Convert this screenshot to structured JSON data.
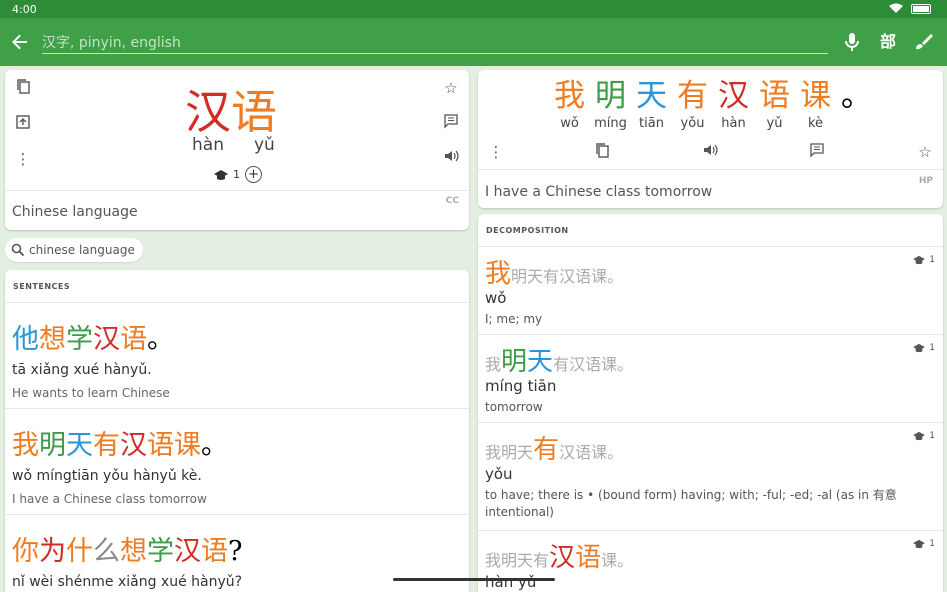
{
  "status": {
    "time": "4:00"
  },
  "toolbar": {
    "search_placeholder": "汉字, pinyin, english",
    "radical_label": "部"
  },
  "word": {
    "chars": [
      "汉",
      "语"
    ],
    "pinyin": [
      "hàn",
      "yǔ"
    ],
    "hsk_level": "1",
    "definition": "Chinese language",
    "source": "CC"
  },
  "chip": {
    "label": "chinese language"
  },
  "sentences": {
    "title": "SENTENCES",
    "items": [
      {
        "chars": [
          [
            "他",
            "c-blue"
          ],
          [
            "想",
            "c-orange"
          ],
          [
            "学",
            "c-green"
          ],
          [
            "汉",
            "c-red"
          ],
          [
            "语",
            "c-orange"
          ],
          [
            "。",
            ""
          ]
        ],
        "pinyin": "tā xiǎng xué hànyǔ.",
        "translation": "He wants to learn Chinese"
      },
      {
        "chars": [
          [
            "我",
            "c-orange"
          ],
          [
            "明",
            "c-green"
          ],
          [
            "天",
            "c-blue"
          ],
          [
            "有",
            "c-orange"
          ],
          [
            "汉",
            "c-red"
          ],
          [
            "语",
            "c-orange"
          ],
          [
            "课",
            "c-orange"
          ],
          [
            "。",
            ""
          ]
        ],
        "pinyin": "wǒ míngtiān yǒu hànyǔ kè.",
        "translation": "I have a Chinese class tomorrow"
      },
      {
        "chars": [
          [
            "你",
            "c-orange"
          ],
          [
            "为",
            "c-red"
          ],
          [
            "什",
            "c-orange"
          ],
          [
            "么",
            "c-gray"
          ],
          [
            "想",
            "c-orange"
          ],
          [
            "学",
            "c-green"
          ],
          [
            "汉",
            "c-red"
          ],
          [
            "语",
            "c-orange"
          ],
          [
            "?",
            ""
          ]
        ],
        "pinyin": "nǐ wèi shénme xiǎng xué hànyǔ?",
        "translation": ""
      }
    ]
  },
  "sentence_card": {
    "chars": [
      [
        "我",
        "c-orange"
      ],
      [
        "明",
        "c-green"
      ],
      [
        "天",
        "c-blue"
      ],
      [
        "有",
        "c-orange"
      ],
      [
        "汉",
        "c-red"
      ],
      [
        "语",
        "c-orange"
      ],
      [
        "课",
        "c-orange"
      ],
      [
        "。",
        ""
      ]
    ],
    "pinyin": [
      "wǒ",
      "míng",
      "tiān",
      "yǒu",
      "hàn",
      "yǔ",
      "kè",
      ""
    ],
    "translation": "I have a Chinese class tomorrow",
    "source": "HP"
  },
  "decomposition": {
    "title": "DECOMPOSITION",
    "items": [
      {
        "pre": [],
        "main": [
          [
            "我",
            "c-orange"
          ]
        ],
        "post": [
          "明",
          "天",
          "有",
          "汉",
          "语",
          "课",
          "。"
        ],
        "pinyin": "wǒ",
        "definition": "I; me; my",
        "hsk": "1"
      },
      {
        "pre": [
          "我"
        ],
        "main": [
          [
            "明",
            "c-green"
          ],
          [
            "天",
            "c-blue"
          ]
        ],
        "post": [
          "有",
          "汉",
          "语",
          "课",
          "。"
        ],
        "pinyin": "míng tiān",
        "definition": "tomorrow",
        "hsk": "1"
      },
      {
        "pre": [
          "我",
          "明",
          "天"
        ],
        "main": [
          [
            "有",
            "c-orange"
          ]
        ],
        "post": [
          "汉",
          "语",
          "课",
          "。"
        ],
        "pinyin": "yǒu",
        "definition": "to have; there is • (bound form) having; with; -ful; -ed; -al (as in 有意 intentional)",
        "hsk": "1"
      },
      {
        "pre": [
          "我",
          "明",
          "天",
          "有"
        ],
        "main": [
          [
            "汉",
            "c-red"
          ],
          [
            "语",
            "c-orange"
          ]
        ],
        "post": [
          "课",
          "。"
        ],
        "pinyin": "hàn yǔ",
        "definition": "",
        "hsk": "1"
      }
    ]
  }
}
